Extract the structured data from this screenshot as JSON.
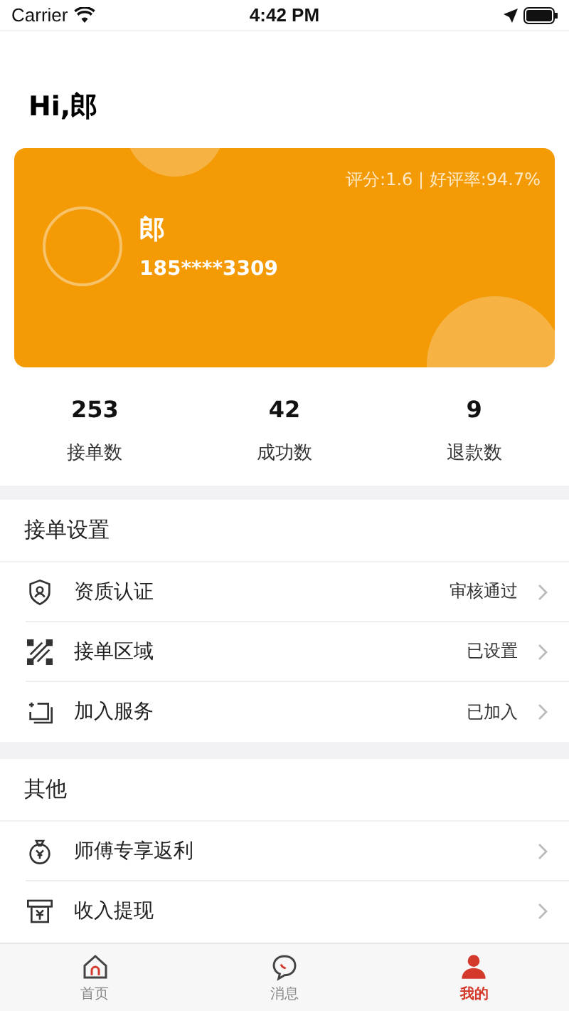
{
  "status_bar": {
    "carrier": "Carrier",
    "time": "4:42 PM"
  },
  "greeting": "Hi,郎",
  "profile": {
    "rating": "评分:1.6 | 好评率:94.7%",
    "name": "郎",
    "phone": "185****3309"
  },
  "stats": [
    {
      "value": "253",
      "label": "接单数"
    },
    {
      "value": "42",
      "label": "成功数"
    },
    {
      "value": "9",
      "label": "退款数"
    }
  ],
  "sections": [
    {
      "title": "接单设置",
      "items": [
        {
          "kind": "shield",
          "label": "资质认证",
          "status": "审核通过"
        },
        {
          "kind": "area",
          "label": "接单区域",
          "status": "已设置"
        },
        {
          "kind": "join",
          "label": "加入服务",
          "status": "已加入"
        }
      ]
    },
    {
      "title": "其他",
      "items": [
        {
          "kind": "bag",
          "label": "师傅专享返利"
        },
        {
          "kind": "cash",
          "label": "收入提现"
        }
      ]
    }
  ],
  "tab_bar": [
    {
      "kind": "home",
      "label": "首页",
      "selected": false
    },
    {
      "kind": "message",
      "label": "消息",
      "selected": false
    },
    {
      "kind": "me",
      "label": "我的",
      "selected": true
    }
  ]
}
